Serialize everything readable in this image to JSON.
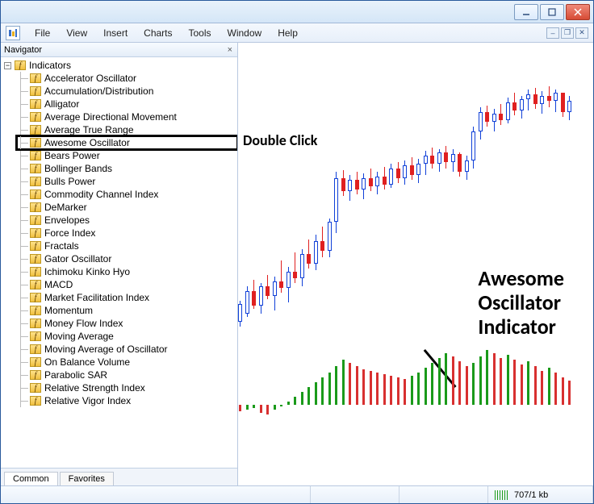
{
  "titlebar": {
    "minimize_icon": "minimize-icon",
    "maximize_icon": "maximize-icon",
    "close_icon": "close-icon"
  },
  "menu": {
    "items": [
      "File",
      "View",
      "Insert",
      "Charts",
      "Tools",
      "Window",
      "Help"
    ]
  },
  "navigator": {
    "title": "Navigator",
    "root_label": "Indicators",
    "items": [
      "Accelerator Oscillator",
      "Accumulation/Distribution",
      "Alligator",
      "Average Directional Movement",
      "Average True Range",
      "Awesome Oscillator",
      "Bears Power",
      "Bollinger Bands",
      "Bulls Power",
      "Commodity Channel Index",
      "DeMarker",
      "Envelopes",
      "Force Index",
      "Fractals",
      "Gator Oscillator",
      "Ichimoku Kinko Hyo",
      "MACD",
      "Market Facilitation Index",
      "Momentum",
      "Money Flow Index",
      "Moving Average",
      "Moving Average of Oscillator",
      "On Balance Volume",
      "Parabolic SAR",
      "Relative Strength Index",
      "Relative Vigor Index"
    ],
    "highlighted_index": 5,
    "tabs": {
      "common": "Common",
      "favorites": "Favorites",
      "active": "common"
    }
  },
  "annotations": {
    "double_click": "Double Click",
    "awesome_line1": "Awesome",
    "awesome_line2": "Oscillator",
    "awesome_line3": "Indicator"
  },
  "statusbar": {
    "connection": "707/1 kb"
  },
  "chart_data": {
    "type": "candlestick_with_oscillator",
    "title": "",
    "note": "Values are approximate pixel-derived prices on an unlabeled axis; y scaled 0-320 from panel top.",
    "candles": [
      {
        "x": 0,
        "high": 280,
        "low": 312,
        "open": 306,
        "close": 284,
        "dir": "up"
      },
      {
        "x": 1,
        "high": 262,
        "low": 300,
        "open": 296,
        "close": 268,
        "dir": "up"
      },
      {
        "x": 2,
        "high": 254,
        "low": 290,
        "open": 268,
        "close": 286,
        "dir": "down"
      },
      {
        "x": 3,
        "high": 258,
        "low": 296,
        "open": 286,
        "close": 262,
        "dir": "up"
      },
      {
        "x": 4,
        "high": 248,
        "low": 278,
        "open": 262,
        "close": 274,
        "dir": "down"
      },
      {
        "x": 5,
        "high": 250,
        "low": 292,
        "open": 274,
        "close": 256,
        "dir": "up"
      },
      {
        "x": 6,
        "high": 230,
        "low": 270,
        "open": 256,
        "close": 264,
        "dir": "down"
      },
      {
        "x": 7,
        "high": 238,
        "low": 282,
        "open": 264,
        "close": 244,
        "dir": "up"
      },
      {
        "x": 8,
        "high": 220,
        "low": 258,
        "open": 244,
        "close": 252,
        "dir": "down"
      },
      {
        "x": 9,
        "high": 216,
        "low": 262,
        "open": 252,
        "close": 222,
        "dir": "up"
      },
      {
        "x": 10,
        "high": 204,
        "low": 240,
        "open": 222,
        "close": 234,
        "dir": "down"
      },
      {
        "x": 11,
        "high": 198,
        "low": 242,
        "open": 234,
        "close": 206,
        "dir": "up"
      },
      {
        "x": 12,
        "high": 188,
        "low": 226,
        "open": 206,
        "close": 218,
        "dir": "down"
      },
      {
        "x": 13,
        "high": 178,
        "low": 226,
        "open": 218,
        "close": 182,
        "dir": "up"
      },
      {
        "x": 14,
        "high": 120,
        "low": 196,
        "open": 182,
        "close": 128,
        "dir": "up"
      },
      {
        "x": 15,
        "high": 118,
        "low": 150,
        "open": 128,
        "close": 144,
        "dir": "down"
      },
      {
        "x": 16,
        "high": 124,
        "low": 156,
        "open": 144,
        "close": 130,
        "dir": "up"
      },
      {
        "x": 17,
        "high": 120,
        "low": 148,
        "open": 130,
        "close": 142,
        "dir": "down"
      },
      {
        "x": 18,
        "high": 122,
        "low": 154,
        "open": 142,
        "close": 128,
        "dir": "up"
      },
      {
        "x": 19,
        "high": 116,
        "low": 144,
        "open": 128,
        "close": 138,
        "dir": "down"
      },
      {
        "x": 20,
        "high": 120,
        "low": 148,
        "open": 138,
        "close": 126,
        "dir": "up"
      },
      {
        "x": 21,
        "high": 114,
        "low": 142,
        "open": 126,
        "close": 136,
        "dir": "down"
      },
      {
        "x": 22,
        "high": 110,
        "low": 140,
        "open": 136,
        "close": 116,
        "dir": "up"
      },
      {
        "x": 23,
        "high": 108,
        "low": 134,
        "open": 116,
        "close": 128,
        "dir": "down"
      },
      {
        "x": 24,
        "high": 106,
        "low": 136,
        "open": 128,
        "close": 112,
        "dir": "up"
      },
      {
        "x": 25,
        "high": 102,
        "low": 130,
        "open": 112,
        "close": 124,
        "dir": "down"
      },
      {
        "x": 26,
        "high": 104,
        "low": 134,
        "open": 124,
        "close": 110,
        "dir": "up"
      },
      {
        "x": 27,
        "high": 94,
        "low": 124,
        "open": 110,
        "close": 100,
        "dir": "up"
      },
      {
        "x": 28,
        "high": 90,
        "low": 116,
        "open": 100,
        "close": 110,
        "dir": "down"
      },
      {
        "x": 29,
        "high": 92,
        "low": 120,
        "open": 110,
        "close": 96,
        "dir": "up"
      },
      {
        "x": 30,
        "high": 88,
        "low": 116,
        "open": 96,
        "close": 108,
        "dir": "down"
      },
      {
        "x": 31,
        "high": 92,
        "low": 120,
        "open": 108,
        "close": 98,
        "dir": "up"
      },
      {
        "x": 32,
        "high": 96,
        "low": 126,
        "open": 98,
        "close": 120,
        "dir": "down"
      },
      {
        "x": 33,
        "high": 100,
        "low": 130,
        "open": 120,
        "close": 106,
        "dir": "up"
      },
      {
        "x": 34,
        "high": 64,
        "low": 116,
        "open": 106,
        "close": 70,
        "dir": "up"
      },
      {
        "x": 35,
        "high": 40,
        "low": 80,
        "open": 70,
        "close": 46,
        "dir": "up"
      },
      {
        "x": 36,
        "high": 38,
        "low": 64,
        "open": 46,
        "close": 58,
        "dir": "down"
      },
      {
        "x": 37,
        "high": 42,
        "low": 70,
        "open": 58,
        "close": 48,
        "dir": "up"
      },
      {
        "x": 38,
        "high": 36,
        "low": 62,
        "open": 48,
        "close": 56,
        "dir": "down"
      },
      {
        "x": 39,
        "high": 28,
        "low": 60,
        "open": 56,
        "close": 34,
        "dir": "up"
      },
      {
        "x": 40,
        "high": 22,
        "low": 50,
        "open": 34,
        "close": 44,
        "dir": "down"
      },
      {
        "x": 41,
        "high": 26,
        "low": 54,
        "open": 44,
        "close": 30,
        "dir": "up"
      },
      {
        "x": 42,
        "high": 18,
        "low": 44,
        "open": 30,
        "close": 24,
        "dir": "up"
      },
      {
        "x": 43,
        "high": 16,
        "low": 42,
        "open": 24,
        "close": 36,
        "dir": "down"
      },
      {
        "x": 44,
        "high": 20,
        "low": 48,
        "open": 36,
        "close": 26,
        "dir": "up"
      },
      {
        "x": 45,
        "high": 14,
        "low": 40,
        "open": 26,
        "close": 32,
        "dir": "down"
      },
      {
        "x": 46,
        "high": 18,
        "low": 46,
        "open": 32,
        "close": 22,
        "dir": "up"
      },
      {
        "x": 47,
        "high": 22,
        "low": 52,
        "open": 22,
        "close": 46,
        "dir": "down"
      },
      {
        "x": 48,
        "high": 26,
        "low": 56,
        "open": 46,
        "close": 32,
        "dir": "up"
      }
    ],
    "oscillator": {
      "baseline": 0,
      "bars": [
        {
          "x": 0,
          "v": -8,
          "c": "neg"
        },
        {
          "x": 1,
          "v": -6,
          "c": "pos"
        },
        {
          "x": 2,
          "v": -4,
          "c": "pos"
        },
        {
          "x": 3,
          "v": -10,
          "c": "neg"
        },
        {
          "x": 4,
          "v": -12,
          "c": "neg"
        },
        {
          "x": 5,
          "v": -6,
          "c": "pos"
        },
        {
          "x": 6,
          "v": -2,
          "c": "pos"
        },
        {
          "x": 7,
          "v": 4,
          "c": "pos"
        },
        {
          "x": 8,
          "v": 10,
          "c": "pos"
        },
        {
          "x": 9,
          "v": 16,
          "c": "pos"
        },
        {
          "x": 10,
          "v": 22,
          "c": "pos"
        },
        {
          "x": 11,
          "v": 28,
          "c": "pos"
        },
        {
          "x": 12,
          "v": 34,
          "c": "pos"
        },
        {
          "x": 13,
          "v": 40,
          "c": "pos"
        },
        {
          "x": 14,
          "v": 48,
          "c": "pos"
        },
        {
          "x": 15,
          "v": 56,
          "c": "pos"
        },
        {
          "x": 16,
          "v": 52,
          "c": "neg"
        },
        {
          "x": 17,
          "v": 48,
          "c": "neg"
        },
        {
          "x": 18,
          "v": 44,
          "c": "neg"
        },
        {
          "x": 19,
          "v": 42,
          "c": "neg"
        },
        {
          "x": 20,
          "v": 40,
          "c": "neg"
        },
        {
          "x": 21,
          "v": 38,
          "c": "neg"
        },
        {
          "x": 22,
          "v": 36,
          "c": "neg"
        },
        {
          "x": 23,
          "v": 34,
          "c": "neg"
        },
        {
          "x": 24,
          "v": 32,
          "c": "neg"
        },
        {
          "x": 25,
          "v": 36,
          "c": "pos"
        },
        {
          "x": 26,
          "v": 40,
          "c": "pos"
        },
        {
          "x": 27,
          "v": 46,
          "c": "pos"
        },
        {
          "x": 28,
          "v": 52,
          "c": "pos"
        },
        {
          "x": 29,
          "v": 58,
          "c": "pos"
        },
        {
          "x": 30,
          "v": 64,
          "c": "pos"
        },
        {
          "x": 31,
          "v": 60,
          "c": "neg"
        },
        {
          "x": 32,
          "v": 54,
          "c": "neg"
        },
        {
          "x": 33,
          "v": 48,
          "c": "neg"
        },
        {
          "x": 34,
          "v": 52,
          "c": "pos"
        },
        {
          "x": 35,
          "v": 60,
          "c": "pos"
        },
        {
          "x": 36,
          "v": 68,
          "c": "pos"
        },
        {
          "x": 37,
          "v": 64,
          "c": "neg"
        },
        {
          "x": 38,
          "v": 58,
          "c": "neg"
        },
        {
          "x": 39,
          "v": 62,
          "c": "pos"
        },
        {
          "x": 40,
          "v": 56,
          "c": "neg"
        },
        {
          "x": 41,
          "v": 50,
          "c": "neg"
        },
        {
          "x": 42,
          "v": 54,
          "c": "pos"
        },
        {
          "x": 43,
          "v": 48,
          "c": "neg"
        },
        {
          "x": 44,
          "v": 42,
          "c": "neg"
        },
        {
          "x": 45,
          "v": 46,
          "c": "pos"
        },
        {
          "x": 46,
          "v": 40,
          "c": "neg"
        },
        {
          "x": 47,
          "v": 34,
          "c": "neg"
        },
        {
          "x": 48,
          "v": 30,
          "c": "neg"
        }
      ]
    }
  }
}
